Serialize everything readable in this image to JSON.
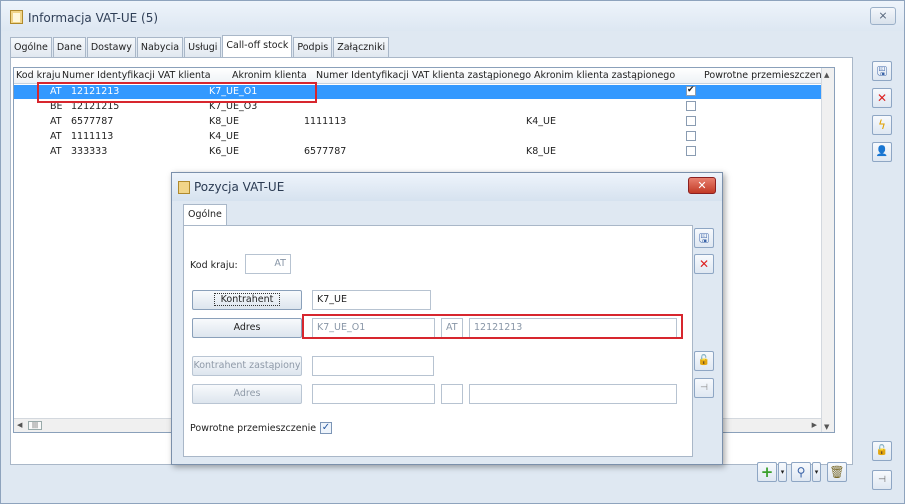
{
  "window": {
    "title": "Informacja VAT-UE (5)",
    "close_label": "⨯"
  },
  "tabs": [
    {
      "label": "Ogólne"
    },
    {
      "label": "Dane"
    },
    {
      "label": "Dostawy"
    },
    {
      "label": "Nabycia"
    },
    {
      "label": "Usługi"
    },
    {
      "label": "Call-off stock",
      "active": true
    },
    {
      "label": "Podpis"
    },
    {
      "label": "Załączniki"
    }
  ],
  "grid": {
    "headers": [
      "Kod kraju",
      "Numer Identyfikacji VAT klienta",
      "Akronim klienta",
      "Numer Identyfikacji VAT klienta zastąpionego",
      "Akronim klienta zastąpionego",
      "Powrotne przemieszczenie"
    ],
    "rows": [
      {
        "kod": "AT",
        "nip": "12121213",
        "akronim": "K7_UE_O1",
        "nip_zast": "",
        "akronim_zast": "",
        "powrotne": true,
        "selected": true
      },
      {
        "kod": "BE",
        "nip": "12121215",
        "akronim": "K7_UE_O3",
        "nip_zast": "",
        "akronim_zast": "",
        "powrotne": false
      },
      {
        "kod": "AT",
        "nip": "6577787",
        "akronim": "K8_UE",
        "nip_zast": "1111113",
        "akronim_zast": "K4_UE",
        "powrotne": false
      },
      {
        "kod": "AT",
        "nip": "1111113",
        "akronim": "K4_UE",
        "nip_zast": "",
        "akronim_zast": "",
        "powrotne": false
      },
      {
        "kod": "AT",
        "nip": "333333",
        "akronim": "K6_UE",
        "nip_zast": "6577787",
        "akronim_zast": "K8_UE",
        "powrotne": false
      }
    ]
  },
  "dialog": {
    "title": "Pozycja VAT-UE",
    "tab": "Ogólne",
    "kod_kraju_label": "Kod kraju:",
    "kod_kraju_value": "AT",
    "kontrahent_button": "Kontrahent",
    "kontrahent_value": "K7_UE",
    "adres_button": "Adres",
    "adres_value": "K7_UE_O1",
    "adres_kraj": "AT",
    "adres_nip": "12121213",
    "kontrahent_zast_button": "Kontrahent zastąpiony",
    "kontrahent_zast_value": "",
    "adres_zast_button": "Adres",
    "adres_zast_value": "",
    "adres_zast_kraj": "",
    "adres_zast_nip": "",
    "powrotne_label": "Powrotne przemieszczenie",
    "powrotne_checked": true
  },
  "icons": {
    "save": "save-icon",
    "delete": "delete-icon",
    "refresh": "lightning-icon",
    "users": "users-icon",
    "lock": "lock-icon",
    "pin": "pin-icon",
    "add": "plus-icon",
    "search": "magnifier-icon",
    "trash": "trash-icon"
  },
  "colors": {
    "selection": "#3399ff",
    "highlight_border": "#d7262e",
    "add_green": "#3aa02c"
  }
}
